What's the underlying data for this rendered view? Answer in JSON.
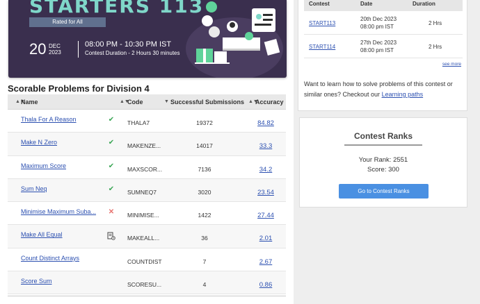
{
  "banner": {
    "title": "STARTERS 113",
    "rated": "Rated for All",
    "day": "20",
    "month": "DEC",
    "year": "2023",
    "time": "08:00 PM - 10:30 PM IST",
    "duration": "Contest Duration - 2  Hours 30 minutes"
  },
  "section_title": "Scorable Problems for Division 4",
  "table": {
    "headers": {
      "name": "Name",
      "code": "Code",
      "subs": "Successful Submissions",
      "accuracy": "Accuracy"
    },
    "rows": [
      {
        "name": "Thala For A Reason",
        "status": "solved",
        "code": "THALA7",
        "subs": "19372",
        "accuracy": "84.82"
      },
      {
        "name": "Make N Zero",
        "status": "solved",
        "code": "MAKENZE...",
        "subs": "14017",
        "accuracy": "33.3"
      },
      {
        "name": "Maximum Score",
        "status": "solved",
        "code": "MAXSCOR...",
        "subs": "7136",
        "accuracy": "34.2"
      },
      {
        "name": "Sum Neq",
        "status": "solved",
        "code": "SUMNEQ7",
        "subs": "3020",
        "accuracy": "23.54"
      },
      {
        "name": "Minimise Maximum Suba...",
        "status": "wrong",
        "code": "MINIMISE...",
        "subs": "1422",
        "accuracy": "27.44"
      },
      {
        "name": "Make All Equal",
        "status": "attempted",
        "code": "MAKEALL...",
        "subs": "36",
        "accuracy": "2.01"
      },
      {
        "name": "Count Distinct Arrays",
        "status": "none",
        "code": "COUNTDIST",
        "subs": "7",
        "accuracy": "2.67"
      },
      {
        "name": "Score Sum",
        "status": "none",
        "code": "SCORESU...",
        "subs": "4",
        "accuracy": "0.86"
      }
    ]
  },
  "contests": {
    "headers": {
      "contest": "Contest",
      "date": "Date",
      "duration": "Duration"
    },
    "rows": [
      {
        "name": "START113",
        "date": "20th Dec 2023",
        "time": "08:00 pm IST",
        "duration": "2 Hrs"
      },
      {
        "name": "START114",
        "date": "27th Dec 2023",
        "time": "08:00 pm IST",
        "duration": "2 Hrs"
      }
    ],
    "see_more": "see more"
  },
  "learn": {
    "text": "Want to learn how to solve problems of this contest or similar ones? Checkout our ",
    "link": "Learning paths"
  },
  "ranks": {
    "title": "Contest Ranks",
    "rank": "Your Rank: 2551",
    "score": "Score: 300",
    "button": "Go to Contest Ranks"
  },
  "colors": {
    "link": "#2b4fb0",
    "solved": "#3aa655",
    "wrong": "#e8736f",
    "button": "#4a90e2",
    "banner_bg": "#3a2f4e",
    "banner_title": "#7fd7c9"
  }
}
